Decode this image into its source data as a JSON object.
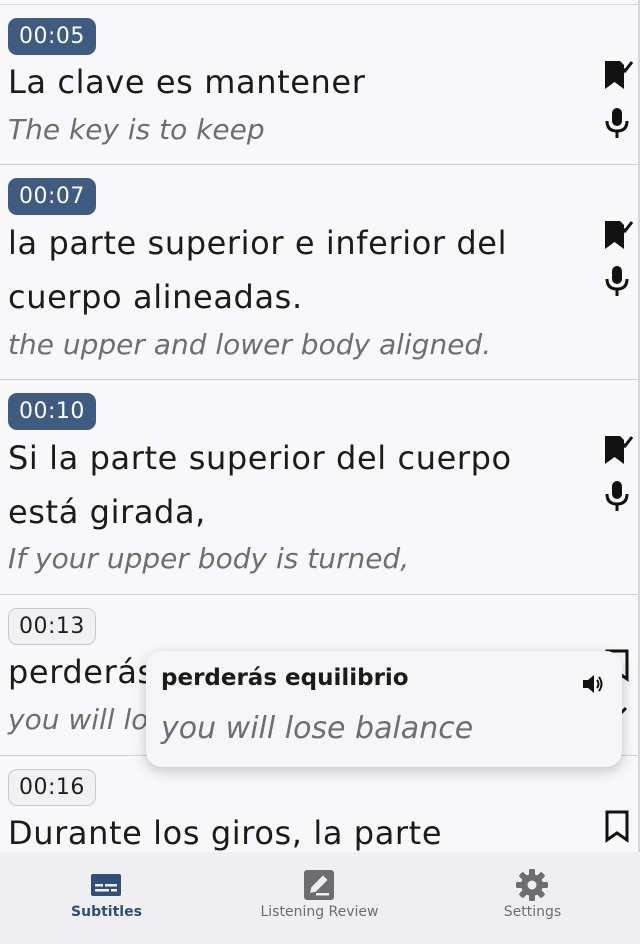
{
  "subtitles": [
    {
      "time": "00:05",
      "original": "La clave es mantener",
      "translation": "The key is to keep",
      "active": true,
      "icons": [
        "bookmark-check-icon",
        "microphone-icon"
      ]
    },
    {
      "time": "00:07",
      "original": "la parte superior e inferior del cuerpo alineadas.",
      "translation": "the upper and lower body aligned.",
      "active": true,
      "icons": [
        "bookmark-check-icon",
        "microphone-icon"
      ]
    },
    {
      "time": "00:10",
      "original": "Si la parte superior del cuerpo está girada,",
      "translation": "If your upper body is turned,",
      "active": true,
      "icons": [
        "bookmark-check-icon",
        "microphone-icon"
      ]
    },
    {
      "time": "00:13",
      "original": "perderás equilibrio.",
      "translation": "you will lose balance.",
      "active": false,
      "icons": [
        "bookmark-icon",
        "chevron-icon"
      ]
    },
    {
      "time": "00:16",
      "original": "Durante los giros, la parte",
      "translation": "",
      "active": false,
      "icons": [
        "bookmark-icon"
      ]
    }
  ],
  "popup": {
    "word": "perderás equilibrio",
    "translation": "you will lose balance",
    "icon": "speaker-icon"
  },
  "tabs": [
    {
      "label": "Subtitles",
      "icon": "subtitles-icon",
      "active": true
    },
    {
      "label": "Listening Review",
      "icon": "pencil-square-icon",
      "active": false
    },
    {
      "label": "Settings",
      "icon": "gear-icon",
      "active": false
    }
  ],
  "colors": {
    "accent": "#3f5b80",
    "active_tab": "#2f4f78",
    "inactive_tab": "#6d6d70",
    "background": "#f8f8fa"
  }
}
